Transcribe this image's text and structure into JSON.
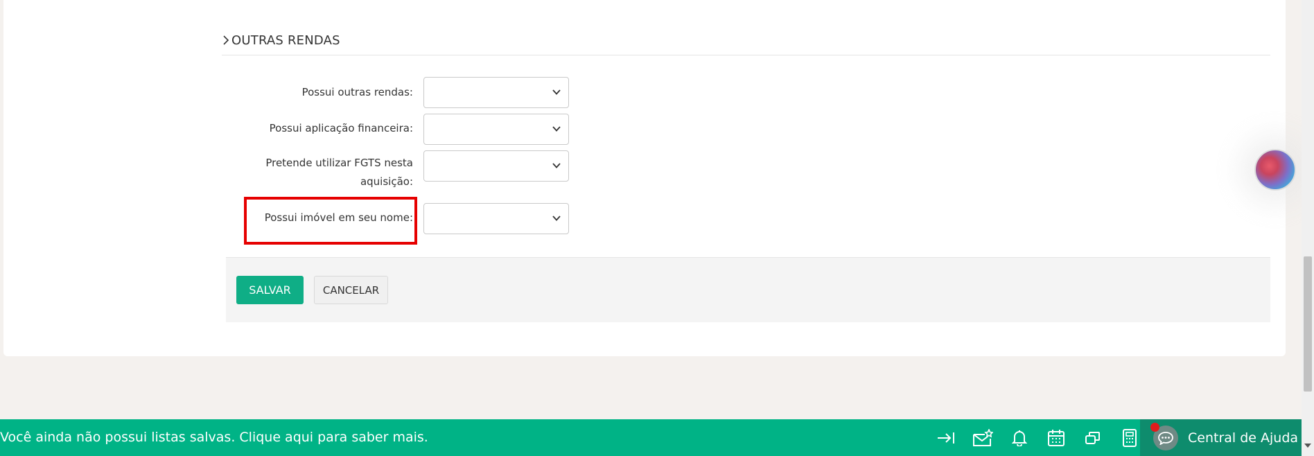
{
  "section": {
    "title": "OUTRAS RENDAS",
    "icon": "chevron-right-icon"
  },
  "fields": [
    {
      "label": "Possui outras rendas:",
      "value": ""
    },
    {
      "label": "Possui aplicação financeira:",
      "value": ""
    },
    {
      "label_line1": "Pretende utilizar FGTS nesta",
      "label_line2": "aquisição:",
      "value": ""
    },
    {
      "label": "Possui imóvel em seu nome:",
      "value": ""
    }
  ],
  "actions": {
    "save": "SALVAR",
    "cancel": "CANCELAR"
  },
  "bottom_bar": {
    "message": "Você ainda não possui listas salvas. Clique aqui para saber mais.",
    "icons": [
      "collapse-right-icon",
      "mail-star-icon",
      "bell-icon",
      "calendar-icon",
      "windows-icon",
      "calculator-icon"
    ],
    "help_label": "Central de Ajuda",
    "accent": "#00b386"
  },
  "colors": {
    "primary": "#0fae86",
    "highlight": "#e60000"
  }
}
